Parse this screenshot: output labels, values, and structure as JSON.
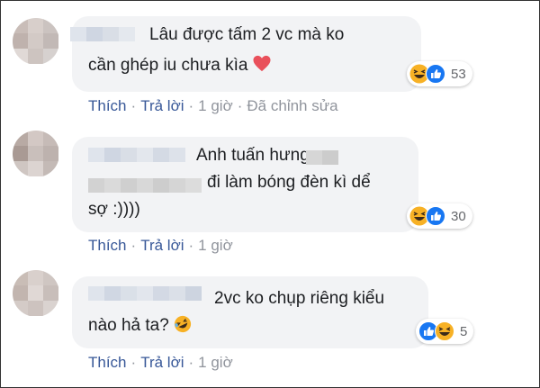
{
  "colors": {
    "link": "#385898",
    "meta": "#90949c",
    "bubble": "#f2f3f5",
    "heart": "#e9505b",
    "like": "#1877f2",
    "haha": "#f7b125"
  },
  "comments": [
    {
      "text_line1": "Lâu được tấm 2 vc mà ko",
      "text_line2": "cần ghép iu chưa kìa",
      "trailing_icon": "heart-icon",
      "reactions": [
        "haha-icon",
        "like-icon"
      ],
      "reaction_count": "53",
      "actions": {
        "like": "Thích",
        "reply": "Trả lời",
        "time": "1 giờ",
        "edited": "Đã chỉnh sửa"
      }
    },
    {
      "text_line1": "Anh tuấn hưng",
      "text_line2": "đi làm bóng đèn kì dể",
      "text_line3": "sợ :))))",
      "reactions": [
        "haha-icon",
        "like-icon"
      ],
      "reaction_count": "30",
      "actions": {
        "like": "Thích",
        "reply": "Trả lời",
        "time": "1 giờ"
      }
    },
    {
      "text_line1": "2vc ko chụp riêng kiểu",
      "text_line2": "nào hả ta?",
      "trailing_icon": "rofl-emoji-icon",
      "reactions": [
        "like-icon",
        "haha-icon"
      ],
      "reaction_count": "5",
      "actions": {
        "like": "Thích",
        "reply": "Trả lời",
        "time": "1 giờ"
      }
    }
  ],
  "separator": "·"
}
